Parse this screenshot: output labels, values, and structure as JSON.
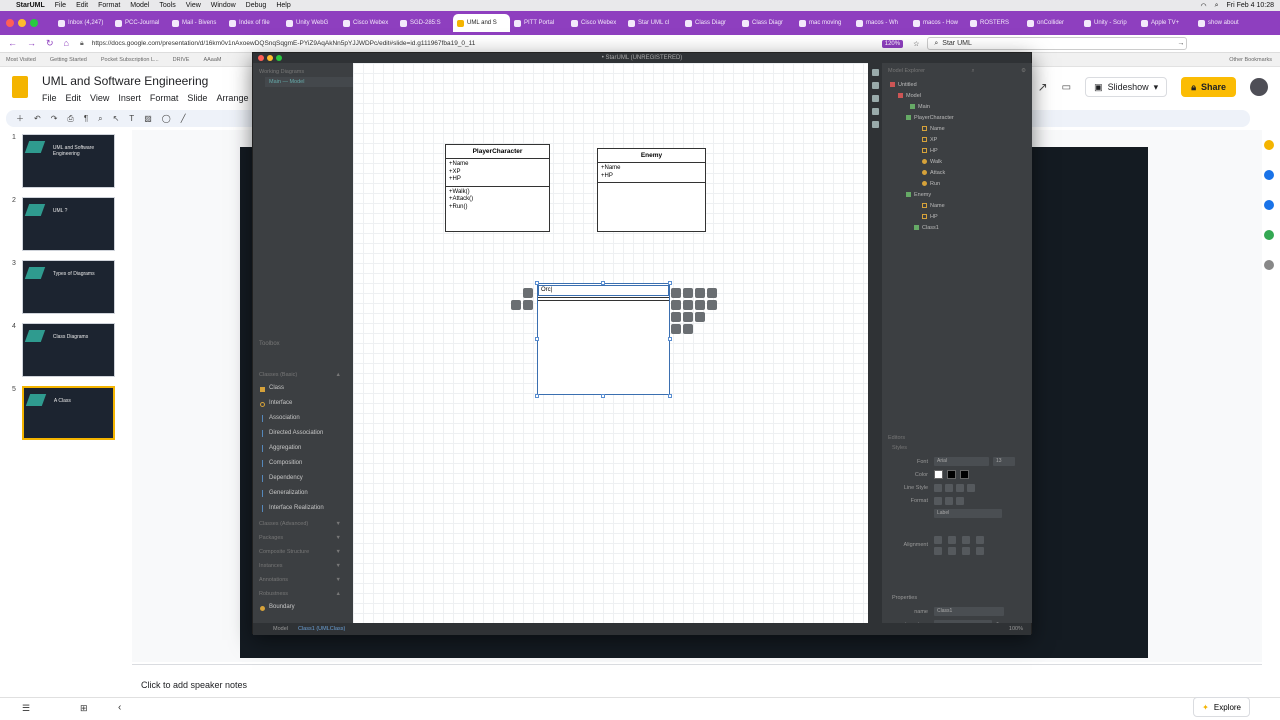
{
  "mac_menu": {
    "app": "StarUML",
    "items": [
      "File",
      "Edit",
      "Format",
      "Model",
      "Tools",
      "View",
      "Window",
      "Debug",
      "Help"
    ],
    "datetime": "Fri Feb 4  10:28"
  },
  "browser": {
    "tabs": [
      {
        "label": "Inbox (4,247)"
      },
      {
        "label": "PCC-Journal"
      },
      {
        "label": "Mail - Bivens"
      },
      {
        "label": "Index of file"
      },
      {
        "label": "Unity WebG"
      },
      {
        "label": "Cisco Webex"
      },
      {
        "label": "SGD-285:S"
      },
      {
        "label": "UML and S",
        "active": true
      },
      {
        "label": "PITT Portal"
      },
      {
        "label": "Cisco Webex"
      },
      {
        "label": "Star UML cl"
      },
      {
        "label": "Class Diagr"
      },
      {
        "label": "Class Diagr"
      },
      {
        "label": "mac moving"
      },
      {
        "label": "macos - Wh"
      },
      {
        "label": "macos - How"
      },
      {
        "label": "ROSTERS"
      },
      {
        "label": "onCollider"
      },
      {
        "label": "Unity - Scrip"
      },
      {
        "label": "Apple TV+"
      },
      {
        "label": "show about"
      }
    ],
    "url": "https://docs.google.com/presentation/d/16km0v1nAxoewDQSnqSqgmE-PYiZ9AqAkNn5pYJJWDPc/edit#slide=id.g111967fba19_0_11",
    "zoom": "120%",
    "search_value": "Star UML",
    "bookmarks": [
      "Most Visited",
      "Getting Started",
      "Pocket Subscription L...",
      "DRIVE",
      "AAaaM"
    ],
    "other_bookmarks": "Other Bookmarks"
  },
  "slides": {
    "title": "UML and Software Engineering",
    "menu": [
      "File",
      "Edit",
      "View",
      "Insert",
      "Format",
      "Slide",
      "Arrange",
      "To"
    ],
    "slideshow_label": "Slideshow",
    "share_label": "Share",
    "thumbnails": [
      {
        "num": "1",
        "text": "UML and Software Engineering"
      },
      {
        "num": "2",
        "text": "UML ?"
      },
      {
        "num": "3",
        "text": "Types of Diagrams"
      },
      {
        "num": "4",
        "text": "Class Diagrams"
      },
      {
        "num": "5",
        "text": "A Class"
      }
    ],
    "notes_placeholder": "Click to add speaker notes",
    "explore_label": "Explore"
  },
  "staruml": {
    "window_title": "• StarUML (UNREGISTERED)",
    "working_diagrams_label": "Working Diagrams",
    "working_diagram_item": "Main — Model",
    "toolbox_label": "Toolbox",
    "toolbox_groups": {
      "classes_basic": "Classes (Basic)",
      "classes_advanced": "Classes (Advanced)",
      "packages": "Packages",
      "composite": "Composite Structure",
      "instances": "Instances",
      "annotations": "Annotations",
      "robustness": "Robustness"
    },
    "toolbox_items": [
      "Class",
      "Interface",
      "Association",
      "Directed Association",
      "Aggregation",
      "Composition",
      "Dependency",
      "Generalization",
      "Interface Realization"
    ],
    "boundary_item": "Boundary",
    "model_explorer_label": "Model Explorer",
    "tree": [
      {
        "label": "Untitled",
        "level": 0
      },
      {
        "label": "Model",
        "level": 1
      },
      {
        "label": "Main",
        "level": 2
      },
      {
        "label": "PlayerCharacter",
        "level": 2
      },
      {
        "label": "Name",
        "level": 3
      },
      {
        "label": "XP",
        "level": 3
      },
      {
        "label": "HP",
        "level": 3
      },
      {
        "label": "Walk",
        "level": 3
      },
      {
        "label": "Attack",
        "level": 3
      },
      {
        "label": "Run",
        "level": 3
      },
      {
        "label": "Enemy",
        "level": 2
      },
      {
        "label": "Name",
        "level": 3
      },
      {
        "label": "HP",
        "level": 3
      },
      {
        "label": "Class1",
        "level": 2
      }
    ],
    "editors_label": "Editors",
    "styles_label": "Styles",
    "font_label": "Font",
    "font_value": "Arial",
    "font_size": "13",
    "color_label": "Color",
    "line_style_label": "Line Style",
    "format_label": "Format",
    "format_value": "Label",
    "alignment_label": "Alignment",
    "properties_label": "Properties",
    "prop_name_label": "name",
    "prop_name_value": "Class1",
    "prop_stereotype_label": "stereotype",
    "status_model": "Model",
    "status_selected": "Class1 (UMLClass)",
    "status_zoom": "100%",
    "classes": {
      "player": {
        "name": "PlayerCharacter",
        "attributes": [
          "+Name",
          "+XP",
          "+HP"
        ],
        "operations": [
          "+Walk()",
          "+Attack()",
          "+Run()"
        ]
      },
      "enemy": {
        "name": "Enemy",
        "attributes": [
          "+Name",
          "+HP"
        ],
        "operations": []
      },
      "editing": {
        "input_value": "Orc|"
      }
    }
  }
}
